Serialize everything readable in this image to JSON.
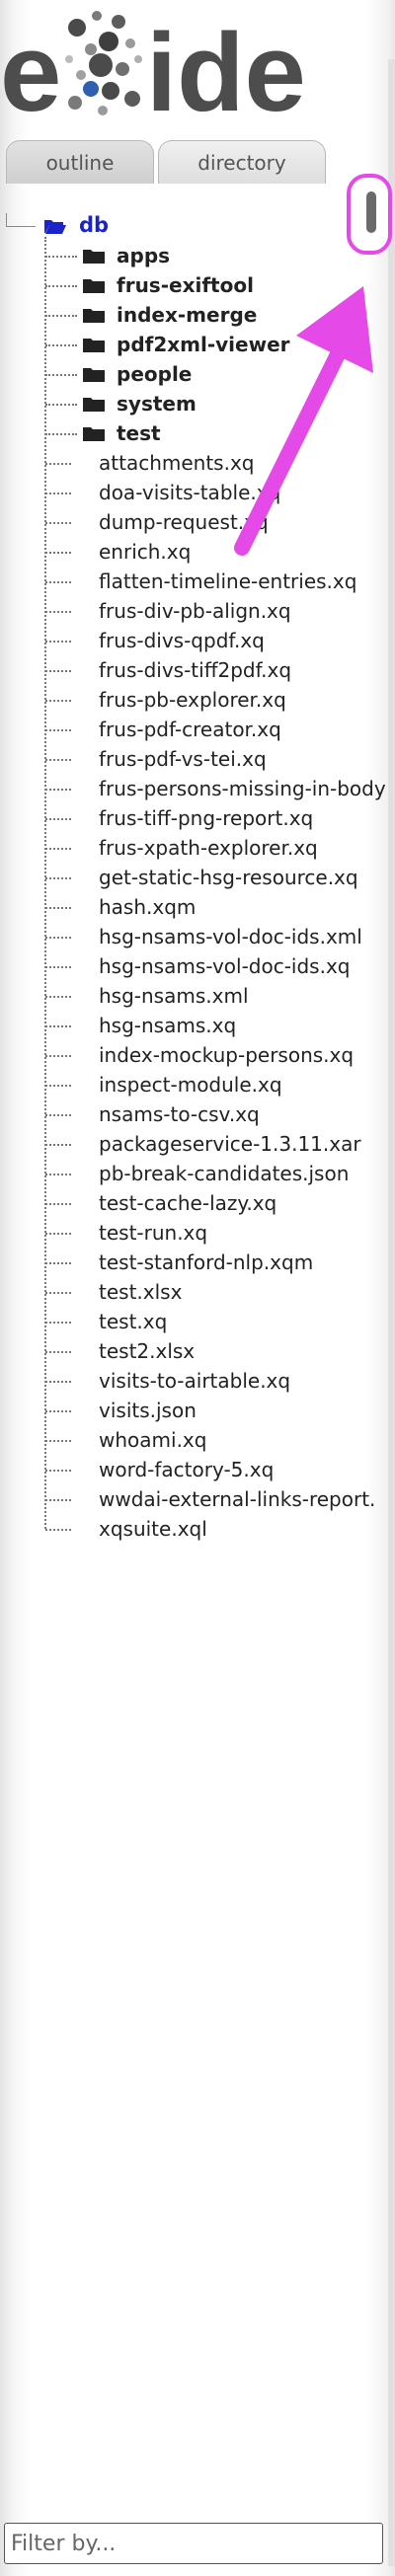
{
  "logo": {
    "text": "eXide"
  },
  "tabs": [
    {
      "label": "outline",
      "selected": false
    },
    {
      "label": "directory",
      "selected": true
    }
  ],
  "tree": {
    "root": {
      "label": "db",
      "icon": "folder-open-icon",
      "color": "#1a24c8"
    },
    "directories": [
      {
        "label": "apps",
        "icon": "folder-icon"
      },
      {
        "label": "frus-exiftool",
        "icon": "folder-icon"
      },
      {
        "label": "index-merge",
        "icon": "folder-icon"
      },
      {
        "label": "pdf2xml-viewer",
        "icon": "folder-icon"
      },
      {
        "label": "people",
        "icon": "folder-icon"
      },
      {
        "label": "system",
        "icon": "folder-icon"
      },
      {
        "label": "test",
        "icon": "folder-icon"
      }
    ],
    "files": [
      "attachments.xq",
      "doa-visits-table.xq",
      "dump-request.xq",
      "enrich.xq",
      "flatten-timeline-entries.xq",
      "frus-div-pb-align.xq",
      "frus-divs-qpdf.xq",
      "frus-divs-tiff2pdf.xq",
      "frus-pb-explorer.xq",
      "frus-pdf-creator.xq",
      "frus-pdf-vs-tei.xq",
      "frus-persons-missing-in-body",
      "frus-tiff-png-report.xq",
      "frus-xpath-explorer.xq",
      "get-static-hsg-resource.xq",
      "hash.xqm",
      "hsg-nsams-vol-doc-ids.xml",
      "hsg-nsams-vol-doc-ids.xq",
      "hsg-nsams.xml",
      "hsg-nsams.xq",
      "index-mockup-persons.xq",
      "inspect-module.xq",
      "nsams-to-csv.xq",
      "packageservice-1.3.11.xar",
      "pb-break-candidates.json",
      "test-cache-lazy.xq",
      "test-run.xq",
      "test-stanford-nlp.xqm",
      "test.xlsx",
      "test.xq",
      "test2.xlsx",
      "visits-to-airtable.xq",
      "visits.json",
      "whoami.xq",
      "word-factory-5.xq",
      "wwdai-external-links-report.",
      "xqsuite.xql"
    ]
  },
  "filter": {
    "placeholder": "Filter by..."
  },
  "annotation": {
    "color": "#e54ae8"
  }
}
